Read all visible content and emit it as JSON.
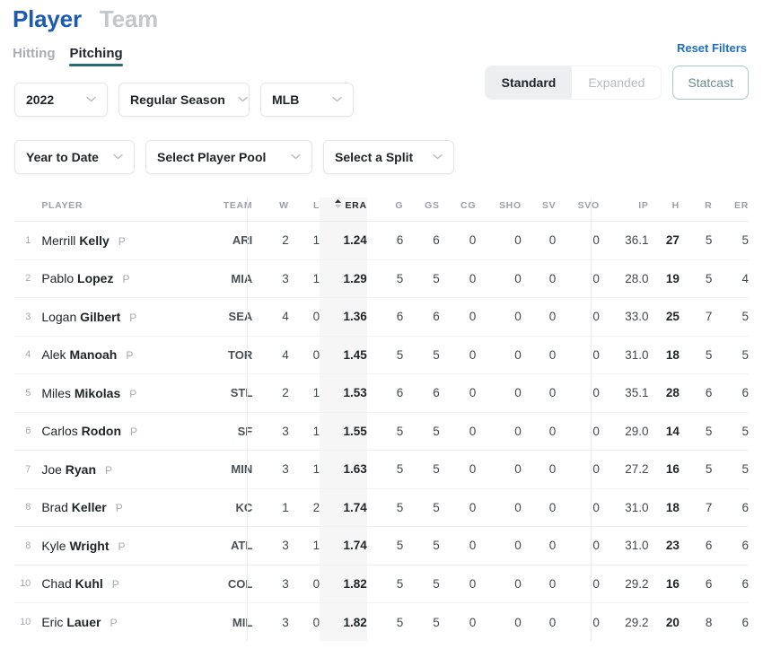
{
  "topnav": {
    "player": "Player",
    "team": "Team"
  },
  "subtabs": {
    "hitting": "Hitting",
    "pitching": "Pitching"
  },
  "filters": {
    "season": "2022",
    "season_type": "Regular Season",
    "league": "MLB",
    "date_range": "Year to Date",
    "player_pool": "Select Player Pool",
    "split": "Select a Split",
    "chevron": "chevron-down-icon"
  },
  "controls": {
    "reset": "Reset Filters",
    "standard": "Standard",
    "expanded": "Expanded",
    "statcast": "Statcast"
  },
  "colors": {
    "brand_blue": "#1c5bb0",
    "link_blue": "#1c6fc4",
    "tab_underline": "#2b6a72",
    "statcast_border": "#a8c7c9",
    "sorted_column_bg": "#f6f6f7",
    "muted_text": "#9ba0a6"
  },
  "table": {
    "sorted_column": "ERA",
    "sort_direction": "asc",
    "columns": [
      {
        "key": "rank",
        "label": ""
      },
      {
        "key": "player",
        "label": "PLAYER"
      },
      {
        "key": "team",
        "label": "TEAM"
      },
      {
        "key": "w",
        "label": "W"
      },
      {
        "key": "l",
        "label": "L"
      },
      {
        "key": "era",
        "label": "ERA"
      },
      {
        "key": "g",
        "label": "G"
      },
      {
        "key": "gs",
        "label": "GS"
      },
      {
        "key": "cg",
        "label": "CG"
      },
      {
        "key": "sho",
        "label": "SHO"
      },
      {
        "key": "sv",
        "label": "SV"
      },
      {
        "key": "svo",
        "label": "SVO"
      },
      {
        "key": "ip",
        "label": "IP"
      },
      {
        "key": "h",
        "label": "H"
      },
      {
        "key": "r",
        "label": "R"
      },
      {
        "key": "er",
        "label": "ER"
      }
    ],
    "rows": [
      {
        "rank": "1",
        "first": "Merrill",
        "last": "Kelly",
        "pos": "P",
        "team": "ARI",
        "w": "2",
        "l": "1",
        "era": "1.24",
        "g": "6",
        "gs": "6",
        "cg": "0",
        "sho": "0",
        "sv": "0",
        "svo": "0",
        "ip": "36.1",
        "h": "27",
        "r": "5",
        "er": "5"
      },
      {
        "rank": "2",
        "first": "Pablo",
        "last": "Lopez",
        "pos": "P",
        "team": "MIA",
        "w": "3",
        "l": "1",
        "era": "1.29",
        "g": "5",
        "gs": "5",
        "cg": "0",
        "sho": "0",
        "sv": "0",
        "svo": "0",
        "ip": "28.0",
        "h": "19",
        "r": "5",
        "er": "4"
      },
      {
        "rank": "3",
        "first": "Logan",
        "last": "Gilbert",
        "pos": "P",
        "team": "SEA",
        "w": "4",
        "l": "0",
        "era": "1.36",
        "g": "6",
        "gs": "6",
        "cg": "0",
        "sho": "0",
        "sv": "0",
        "svo": "0",
        "ip": "33.0",
        "h": "25",
        "r": "7",
        "er": "5"
      },
      {
        "rank": "4",
        "first": "Alek",
        "last": "Manoah",
        "pos": "P",
        "team": "TOR",
        "w": "4",
        "l": "0",
        "era": "1.45",
        "g": "5",
        "gs": "5",
        "cg": "0",
        "sho": "0",
        "sv": "0",
        "svo": "0",
        "ip": "31.0",
        "h": "18",
        "r": "5",
        "er": "5"
      },
      {
        "rank": "5",
        "first": "Miles",
        "last": "Mikolas",
        "pos": "P",
        "team": "STL",
        "w": "2",
        "l": "1",
        "era": "1.53",
        "g": "6",
        "gs": "6",
        "cg": "0",
        "sho": "0",
        "sv": "0",
        "svo": "0",
        "ip": "35.1",
        "h": "28",
        "r": "6",
        "er": "6"
      },
      {
        "rank": "6",
        "first": "Carlos",
        "last": "Rodon",
        "pos": "P",
        "team": "SF",
        "w": "3",
        "l": "1",
        "era": "1.55",
        "g": "5",
        "gs": "5",
        "cg": "0",
        "sho": "0",
        "sv": "0",
        "svo": "0",
        "ip": "29.0",
        "h": "14",
        "r": "5",
        "er": "5"
      },
      {
        "rank": "7",
        "first": "Joe",
        "last": "Ryan",
        "pos": "P",
        "team": "MIN",
        "w": "3",
        "l": "1",
        "era": "1.63",
        "g": "5",
        "gs": "5",
        "cg": "0",
        "sho": "0",
        "sv": "0",
        "svo": "0",
        "ip": "27.2",
        "h": "16",
        "r": "5",
        "er": "5"
      },
      {
        "rank": "8",
        "first": "Brad",
        "last": "Keller",
        "pos": "P",
        "team": "KC",
        "w": "1",
        "l": "2",
        "era": "1.74",
        "g": "5",
        "gs": "5",
        "cg": "0",
        "sho": "0",
        "sv": "0",
        "svo": "0",
        "ip": "31.0",
        "h": "18",
        "r": "7",
        "er": "6"
      },
      {
        "rank": "8",
        "first": "Kyle",
        "last": "Wright",
        "pos": "P",
        "team": "ATL",
        "w": "3",
        "l": "1",
        "era": "1.74",
        "g": "5",
        "gs": "5",
        "cg": "0",
        "sho": "0",
        "sv": "0",
        "svo": "0",
        "ip": "31.0",
        "h": "23",
        "r": "6",
        "er": "6"
      },
      {
        "rank": "10",
        "first": "Chad",
        "last": "Kuhl",
        "pos": "P",
        "team": "COL",
        "w": "3",
        "l": "0",
        "era": "1.82",
        "g": "5",
        "gs": "5",
        "cg": "0",
        "sho": "0",
        "sv": "0",
        "svo": "0",
        "ip": "29.2",
        "h": "16",
        "r": "6",
        "er": "6"
      },
      {
        "rank": "10",
        "first": "Eric",
        "last": "Lauer",
        "pos": "P",
        "team": "MIL",
        "w": "3",
        "l": "0",
        "era": "1.82",
        "g": "5",
        "gs": "5",
        "cg": "0",
        "sho": "0",
        "sv": "0",
        "svo": "0",
        "ip": "29.2",
        "h": "20",
        "r": "8",
        "er": "6"
      }
    ]
  }
}
